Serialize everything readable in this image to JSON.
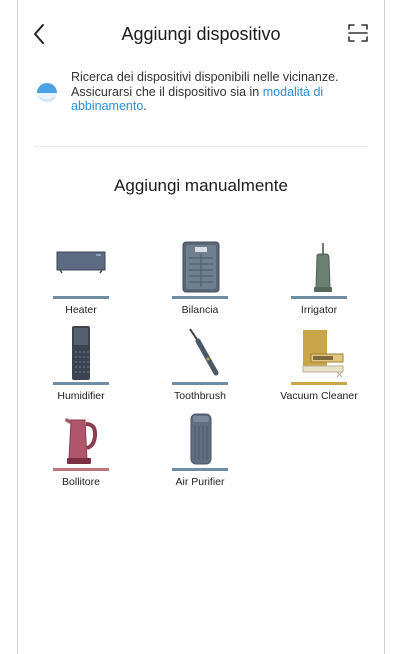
{
  "header": {
    "title": "Aggiungi dispositivo"
  },
  "search": {
    "text": "Ricerca dei dispositivi disponibili nelle vicinanze. Assicurarsi che il dispositivo sia in ",
    "link": "modalità di abbinamento",
    "suffix": "."
  },
  "section": {
    "title": "Aggiungi manualmente"
  },
  "devices": [
    {
      "label": "Heater",
      "icon": "heater-icon"
    },
    {
      "label": "Bilancia",
      "icon": "scale-icon"
    },
    {
      "label": "Irrigator",
      "icon": "irrigator-icon"
    },
    {
      "label": "Humidifier",
      "icon": "humidifier-icon"
    },
    {
      "label": "Toothbrush",
      "icon": "toothbrush-icon"
    },
    {
      "label": "Vacuum Cleaner",
      "icon": "vacuum-cleaner-icon"
    },
    {
      "label": "Bollitore",
      "icon": "kettle-icon"
    },
    {
      "label": "Air Purifier",
      "icon": "air-purifier-icon"
    }
  ],
  "colors": {
    "link": "#2d8fd6",
    "bar_default": "#6f8da5",
    "bar_vacuum": "#c9a64a",
    "bar_kettle": "#c1727b"
  }
}
